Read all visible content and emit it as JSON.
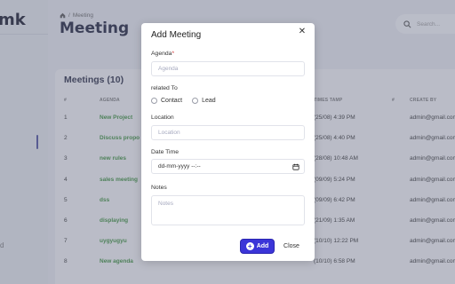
{
  "app": {
    "logo_text": "mk",
    "sidebar_fragment": "d"
  },
  "breadcrumb": {
    "current": "Meeting"
  },
  "page": {
    "title": "Meeting"
  },
  "search": {
    "placeholder": "Search..."
  },
  "meetings": {
    "title": "Meetings (10)",
    "columns": [
      "#",
      "AGENDA",
      "TIMES TAMP",
      "#",
      "CREATE BY"
    ],
    "rows": [
      {
        "num": "1",
        "agenda": "New Project",
        "time": "(25/08) 4:39 PM",
        "creator": "admin@gmail.com"
      },
      {
        "num": "2",
        "agenda": "Discuss propo",
        "time": "(25/08) 4:40 PM",
        "creator": "admin@gmail.com"
      },
      {
        "num": "3",
        "agenda": "new rules",
        "time": "(28/08) 10:48 AM",
        "creator": "admin@gmail.com"
      },
      {
        "num": "4",
        "agenda": "sales meeting",
        "time": "(09/09) 5:24 PM",
        "creator": "admin@gmail.com"
      },
      {
        "num": "5",
        "agenda": "dss",
        "time": "(09/09) 6:42 PM",
        "creator": "admin@gmail.com"
      },
      {
        "num": "6",
        "agenda": "displaying",
        "time": "(21/09) 1:35 AM",
        "creator": "admin@gmail.com"
      },
      {
        "num": "7",
        "agenda": "uygyugyu",
        "time": "(10/10) 12:22 PM",
        "creator": "admin@gmail.com"
      },
      {
        "num": "8",
        "agenda": "New agenda",
        "time": "(10/10) 6:58 PM",
        "creator": "admin@gmail.com"
      }
    ]
  },
  "modal": {
    "title": "Add Meeting",
    "agenda_label": "Agenda",
    "agenda_required_mark": "*",
    "agenda_placeholder": "Agenda",
    "related_label": "related To",
    "related_options": [
      "Contact",
      "Lead"
    ],
    "location_label": "Location",
    "location_placeholder": "Location",
    "datetime_label": "Date Time",
    "datetime_value": "dd-mm-yyyy --:--",
    "notes_label": "Notes",
    "notes_placeholder": "Notes",
    "add_label": "Add",
    "close_label": "Close"
  },
  "icons": {
    "home": "home-icon",
    "search": "search-icon",
    "close": "close-icon",
    "calendar": "calendar-icon",
    "plus": "plus-icon"
  },
  "colors": {
    "primary_button": "#3b35d8",
    "agenda_link": "#3c8f3c",
    "required": "#d03030"
  }
}
